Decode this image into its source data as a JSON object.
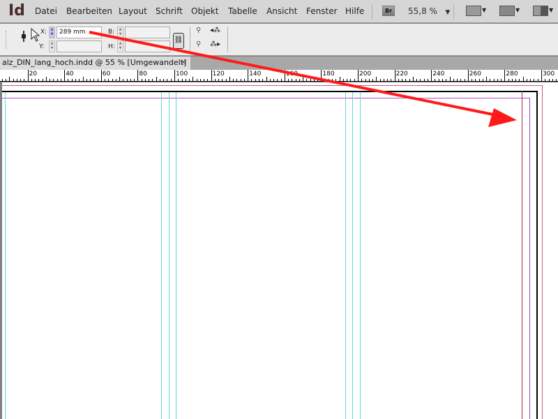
{
  "app": {
    "logo": "Id"
  },
  "menu": [
    "Datei",
    "Bearbeiten",
    "Layout",
    "Schrift",
    "Objekt",
    "Tabelle",
    "Ansicht",
    "Fenster",
    "Hilfe"
  ],
  "toolbar": {
    "bridge_label": "Br",
    "zoom": "55,8 %",
    "dropdown_glyph": "▼"
  },
  "control": {
    "x_label": "X:",
    "x_value": "289 mm",
    "y_label": "Y:",
    "y_value": "",
    "b_label": "B:",
    "b_value": "",
    "h_label": "H:",
    "h_value": ""
  },
  "document_tab": {
    "title": "alz_DIN_lang_hoch.indd @ 55 % [Umgewandelt]",
    "close": "×"
  },
  "ruler": {
    "labels": [
      "20",
      "40",
      "60",
      "80",
      "100",
      "120",
      "140",
      "160",
      "180",
      "200",
      "220",
      "240",
      "260",
      "280",
      "300"
    ]
  },
  "colors": {
    "guide_column": "#5fd8d8",
    "margin": "#b44fc0",
    "bleed": "#c06080",
    "annotation_arrow": "#ff1a1a"
  }
}
